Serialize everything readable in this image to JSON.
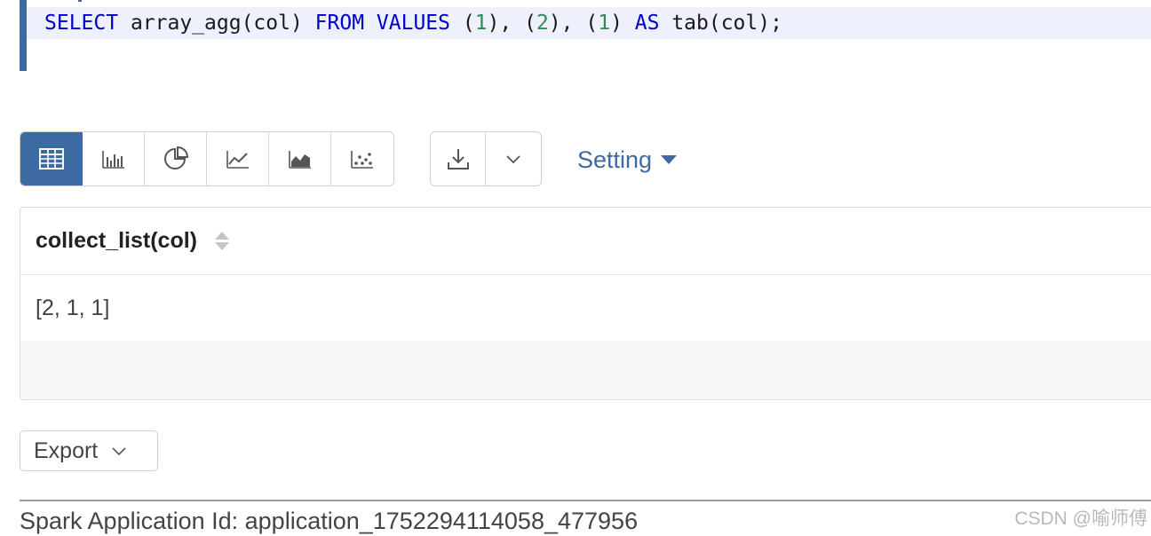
{
  "editor": {
    "tokens": [
      {
        "text": "SELECT",
        "kind": "kw"
      },
      {
        "text": " array_agg(col) ",
        "kind": "plain"
      },
      {
        "text": "FROM",
        "kind": "kw"
      },
      {
        "text": " ",
        "kind": "plain"
      },
      {
        "text": "VALUES",
        "kind": "kw"
      },
      {
        "text": " (",
        "kind": "plain"
      },
      {
        "text": "1",
        "kind": "num"
      },
      {
        "text": "), (",
        "kind": "plain"
      },
      {
        "text": "2",
        "kind": "num"
      },
      {
        "text": "), (",
        "kind": "plain"
      },
      {
        "text": "1",
        "kind": "num"
      },
      {
        "text": ") ",
        "kind": "plain"
      },
      {
        "text": "AS",
        "kind": "kw"
      },
      {
        "text": " tab(col);",
        "kind": "plain"
      }
    ],
    "colors": {
      "keyword": "#0000c8",
      "number": "#2e8b57",
      "gutter": "#3d6aa1"
    }
  },
  "toolbar": {
    "views": [
      {
        "id": "table",
        "icon": "table-icon",
        "active": true
      },
      {
        "id": "bar",
        "icon": "bar-chart-icon",
        "active": false
      },
      {
        "id": "pie",
        "icon": "pie-chart-icon",
        "active": false
      },
      {
        "id": "line",
        "icon": "line-chart-icon",
        "active": false
      },
      {
        "id": "area",
        "icon": "area-chart-icon",
        "active": false
      },
      {
        "id": "scatter",
        "icon": "scatter-chart-icon",
        "active": false
      }
    ],
    "download_icon": "download-icon",
    "dropdown_icon": "chevron-down-icon",
    "setting_label": "Setting",
    "accent": "#3d6aa1"
  },
  "table": {
    "columns": [
      {
        "label": "collect_list(col)"
      }
    ],
    "rows": [
      [
        "[2, 1, 1]"
      ]
    ]
  },
  "export": {
    "label": "Export"
  },
  "footer": {
    "app_id_text": "Spark Application Id: application_1752294114058_477956",
    "watermark": "CSDN @喻师傅"
  }
}
